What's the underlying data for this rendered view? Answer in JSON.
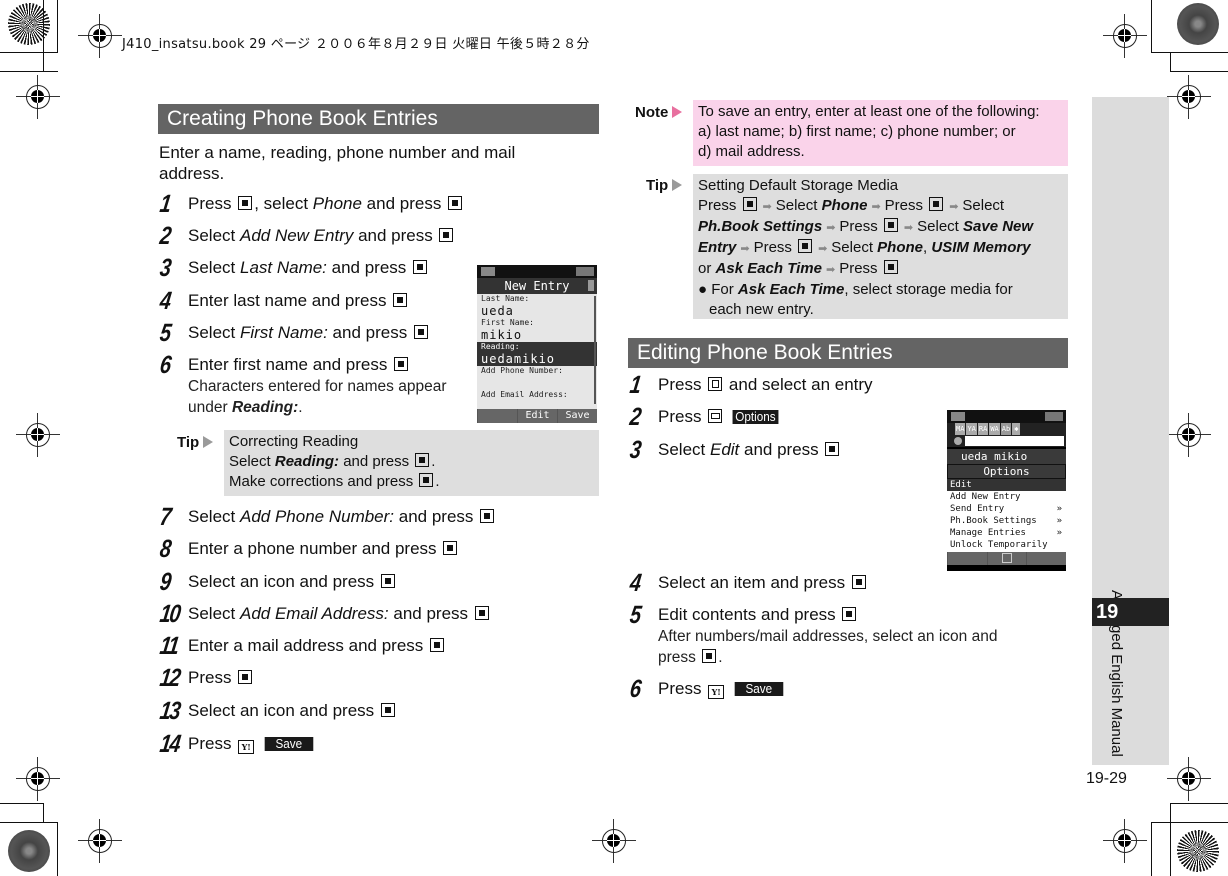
{
  "print_header": "J410_insatsu.book  29 ページ  ２００６年８月２９日  火曜日  午後５時２８分",
  "left": {
    "section_title": "Creating Phone Book Entries",
    "intro": "Enter a name, reading, phone number and mail address.",
    "steps": [
      {
        "num": "1",
        "pre": "Press ",
        "key1": "center-key",
        "mid": ", select ",
        "em": "Phone",
        "post": " and press ",
        "key2": "center-key"
      },
      {
        "num": "2",
        "pre": "Select ",
        "em": "Add New Entry",
        "post": " and press "
      },
      {
        "num": "3",
        "pre": "Select ",
        "em": "Last Name:",
        "post": " and press "
      },
      {
        "num": "4",
        "text": "Enter last name and press "
      },
      {
        "num": "5",
        "pre": "Select ",
        "em": "First Name:",
        "post": " and press "
      },
      {
        "num": "6",
        "text": "Enter first name and press ",
        "sub_pre": "Characters entered for names appear under ",
        "sub_em": "Reading:",
        "sub_post": "."
      },
      {
        "num": "7",
        "pre": "Select ",
        "em": "Add Phone Number:",
        "post": " and press "
      },
      {
        "num": "8",
        "text": "Enter a phone number and press "
      },
      {
        "num": "9",
        "text": "Select an icon and press "
      },
      {
        "num": "10",
        "pre": "Select ",
        "em": "Add Email Address:",
        "post": " and press "
      },
      {
        "num": "11",
        "text": "Enter a mail address and press "
      },
      {
        "num": "12",
        "text": "Press "
      },
      {
        "num": "13",
        "text": "Select an icon and press "
      },
      {
        "num": "14",
        "text": "Press ",
        "softkey": "Save"
      }
    ],
    "tip": {
      "label": "Tip",
      "title": "Correcting Reading",
      "line1_pre": "Select ",
      "line1_em": "Reading:",
      "line1_post": " and press ",
      "line2": "Make corrections and press "
    },
    "phone_screen": {
      "title": "New Entry",
      "fields": [
        {
          "label": "Last Name:",
          "value": "ueda"
        },
        {
          "label": "First Name:",
          "value": "mikio"
        },
        {
          "label": "Reading:",
          "value": "uedamikio",
          "selected": true
        },
        {
          "label": "Add Phone Number:",
          "value": ""
        },
        {
          "label": "Add Email Address:",
          "value": ""
        }
      ],
      "softkeys": [
        "",
        "Edit",
        "Save"
      ]
    }
  },
  "right": {
    "note": {
      "label": "Note",
      "text1": "To save an entry, enter at least one of the following:",
      "text2": "a) last name; b) first name; c) phone number; or",
      "text3": "d) mail address."
    },
    "tip": {
      "label": "Tip",
      "title": "Setting Default Storage Media",
      "press": "Press",
      "select": "Select",
      "phone": "Phone",
      "phbook": "Ph.Book Settings",
      "save_new": "Save New",
      "entry": "Entry",
      "usim": "USIM Memory",
      "or": "or",
      "ask": "Ask Each Time",
      "bullet_pre": "For ",
      "bullet_post": ", select storage media for",
      "bullet_line2": "each new entry."
    },
    "section_title": "Editing Phone Book Entries",
    "steps": [
      {
        "num": "1",
        "pre": "Press ",
        "post": " and select an entry"
      },
      {
        "num": "2",
        "pre": "Press ",
        "softkey": "Options"
      },
      {
        "num": "3",
        "pre": "Select ",
        "em": "Edit",
        "post": " and press "
      },
      {
        "num": "4",
        "text": "Select an item and press "
      },
      {
        "num": "5",
        "text": "Edit contents and press ",
        "sub1": "After numbers/mail addresses, select an icon and",
        "sub2": "press "
      },
      {
        "num": "6",
        "pre": "Press ",
        "softkey": "Save"
      }
    ],
    "phone_screen": {
      "tabs": [
        "MA",
        "YA",
        "RA",
        "WA",
        "Ab",
        "✱"
      ],
      "name": "ueda mikio",
      "menu_title": "Options",
      "items": [
        {
          "label": "Edit",
          "selected": true,
          "submenu": false
        },
        {
          "label": "Add New Entry",
          "submenu": false
        },
        {
          "label": "Send Entry",
          "submenu": true
        },
        {
          "label": "Ph.Book Settings",
          "submenu": true
        },
        {
          "label": "Manage Entries",
          "submenu": true
        },
        {
          "label": "Unlock Temporarily",
          "submenu": false
        }
      ]
    }
  },
  "side": {
    "label": "Abridged English Manual",
    "chapter": "19",
    "page_number": "19-29"
  },
  "colors": {
    "section_bar": "#646464",
    "tip_bg": "#dedede",
    "note_bg": "#fad3ea",
    "note_arrow": "#e8709f",
    "side_tab": "#dcdcdc"
  }
}
